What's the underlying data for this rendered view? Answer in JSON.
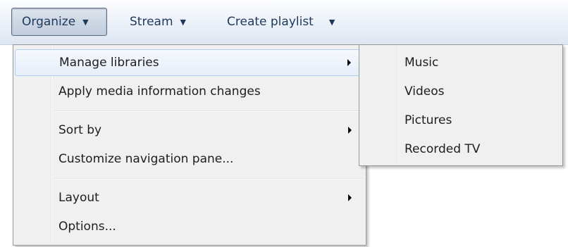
{
  "toolbar": {
    "organize_label": "Organize",
    "stream_label": "Stream",
    "playlist_label": "Create playlist",
    "dropdown_arrow": "▼"
  },
  "organize_menu": {
    "items": [
      {
        "label": "Manage libraries",
        "has_submenu": true
      },
      {
        "label": "Apply media information changes",
        "has_submenu": false
      },
      {
        "label": "Sort by",
        "has_submenu": true
      },
      {
        "label": "Customize navigation pane...",
        "has_submenu": false
      },
      {
        "label": "Layout",
        "has_submenu": true
      },
      {
        "label": "Options...",
        "has_submenu": false
      }
    ]
  },
  "libraries_submenu": {
    "items": [
      {
        "label": "Music"
      },
      {
        "label": "Videos"
      },
      {
        "label": "Pictures"
      },
      {
        "label": "Recorded TV"
      }
    ]
  },
  "colors": {
    "toolbar_text": "#1e395b",
    "menu_background": "#f0f0f0",
    "highlight_border": "#aecff7"
  }
}
